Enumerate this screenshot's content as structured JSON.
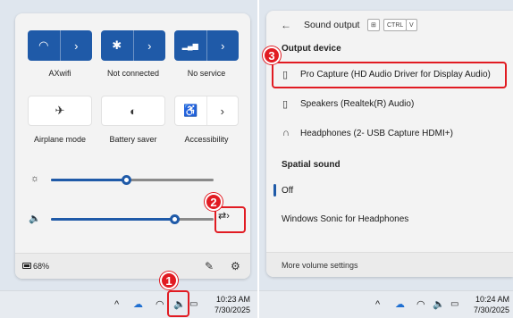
{
  "quick_settings": {
    "tiles": [
      {
        "label": "AXwifi",
        "icon": "wifi-icon",
        "on": true,
        "glyph": "◠",
        "chevron": "›"
      },
      {
        "label": "Not connected",
        "icon": "bluetooth-icon",
        "on": true,
        "glyph": "✱",
        "chevron": "›"
      },
      {
        "label": "No service",
        "icon": "cellular-icon",
        "on": true,
        "glyph": "▂▄▆",
        "chevron": "›"
      },
      {
        "label": "Airplane mode",
        "icon": "airplane-icon",
        "on": false,
        "glyph": "✈"
      },
      {
        "label": "Battery saver",
        "icon": "battery-saver-icon",
        "on": false,
        "glyph": "◐"
      },
      {
        "label": "Accessibility",
        "icon": "accessibility-icon",
        "on": false,
        "glyph": "♿",
        "chevron": "›"
      }
    ],
    "brightness": {
      "icon": "brightness-icon",
      "glyph": "☼",
      "level": 0.46
    },
    "volume": {
      "icon": "speaker-icon",
      "glyph": "🔈",
      "level": 0.76,
      "manage_glyph": "⇄›"
    },
    "battery_text": "68%"
  },
  "taskbar_left": {
    "time": "10:23 AM",
    "date": "7/30/2025"
  },
  "sound_output": {
    "back_glyph": "←",
    "title": "Sound output",
    "shortcut_keys": [
      "⊞",
      "CTRL",
      "V"
    ],
    "output_device_heading": "Output device",
    "devices": [
      {
        "name": "Pro Capture (HD Audio Driver for Display Audio)",
        "icon": "speaker-device-icon",
        "glyph": "▯"
      },
      {
        "name": "Speakers (Realtek(R) Audio)",
        "icon": "speaker-device-icon",
        "glyph": "▯"
      },
      {
        "name": "Headphones (2- USB Capture HDMI+)",
        "icon": "headphones-icon",
        "glyph": "∩"
      }
    ],
    "spatial_heading": "Spatial sound",
    "spatial_options": [
      "Off",
      "Windows Sonic for Headphones"
    ],
    "more_settings": "More volume settings"
  },
  "taskbar_right": {
    "time": "10:24 AM",
    "date": "7/30/2025"
  },
  "callouts": [
    "1",
    "2",
    "3"
  ],
  "colors": {
    "accent": "#1f5aa8",
    "callout": "#e11b22"
  }
}
